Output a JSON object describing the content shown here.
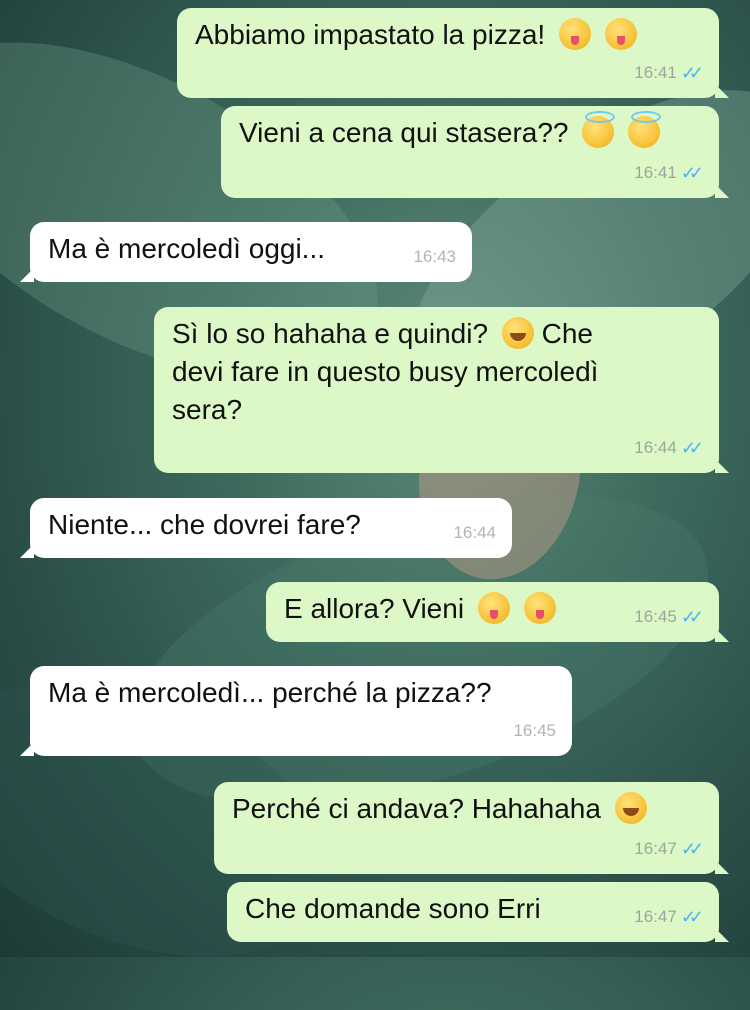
{
  "messages": [
    {
      "direction": "outgoing",
      "text": "Abbiamo impastato la pizza!",
      "emoji": [
        "face-savoring-food-emoji",
        "face-savoring-food-emoji"
      ],
      "time": "16:41",
      "status": "read"
    },
    {
      "direction": "outgoing",
      "text": "Vieni a cena qui stasera??",
      "emoji": [
        "smiling-face-with-halo-emoji",
        "smiling-face-with-halo-emoji"
      ],
      "time": "16:41",
      "status": "read"
    },
    {
      "direction": "incoming",
      "text": "Ma è mercoledì oggi...",
      "emoji": [],
      "time": "16:43"
    },
    {
      "direction": "outgoing",
      "text_line1": "Sì lo so hahaha e quindi?",
      "text_line1b": "Che",
      "text_line2": "devi fare in questo busy mercoledì",
      "text_line3": "sera?",
      "emoji": [
        "rolling-on-floor-laughing-emoji"
      ],
      "time": "16:44",
      "status": "read"
    },
    {
      "direction": "incoming",
      "text": "Niente... che dovrei fare?",
      "emoji": [],
      "time": "16:44"
    },
    {
      "direction": "outgoing",
      "text": "E allora? Vieni",
      "emoji": [
        "face-savoring-food-emoji",
        "face-savoring-food-emoji"
      ],
      "time": "16:45",
      "status": "read"
    },
    {
      "direction": "incoming",
      "text": "Ma è mercoledì... perché la pizza??",
      "emoji": [],
      "time": "16:45"
    },
    {
      "direction": "outgoing",
      "text": "Perché ci andava? Hahahaha",
      "emoji": [
        "rolling-on-floor-laughing-emoji"
      ],
      "time": "16:47",
      "status": "read"
    },
    {
      "direction": "outgoing",
      "text": "Che domande sono Erri",
      "emoji": [],
      "time": "16:47",
      "status": "read"
    }
  ],
  "ticks_glyph": "✓✓",
  "colors": {
    "outgoing_bubble": "#dcf8c6",
    "incoming_bubble": "#ffffff",
    "read_ticks": "#4fb3f6"
  }
}
